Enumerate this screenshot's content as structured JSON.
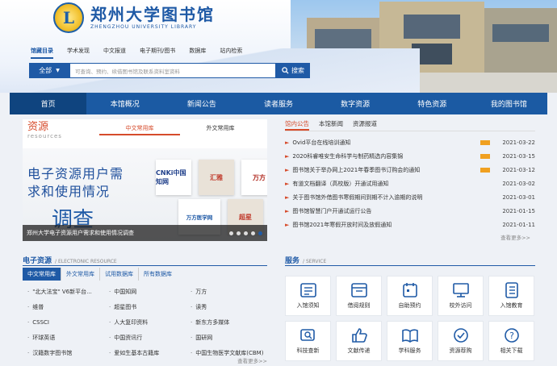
{
  "header": {
    "logo_cn": "郑州大学图书馆",
    "logo_en": "ZHENGZHOU UNIVERSITY LIBRARY",
    "emblem_letter": "L",
    "search_tabs": [
      "馆藏目录",
      "学术发现",
      "中文报道",
      "电子期刊/图书",
      "数据库",
      "站内检索"
    ],
    "active_search_tab": 0,
    "search_scope": "全部",
    "search_placeholder": "可查询、预约、续借图书馆及联系资料室资料",
    "search_button": "搜索"
  },
  "nav": {
    "items": [
      "首页",
      "本馆概况",
      "新闻公告",
      "读者服务",
      "数字资源",
      "特色资源",
      "我的图书馆"
    ],
    "active": 0
  },
  "resources": {
    "title_cn": "资源",
    "title_en": "resources",
    "tabs": [
      "中文常用库",
      "外文常用库"
    ],
    "banner_line1": "电子资源用户需",
    "banner_line2": "求和使用情况",
    "banner_big": "调查",
    "banner_caption": "郑州大学电子资源用户需求和使用情况调查",
    "logos": [
      "CNKi中国知网",
      "汇雅",
      "万方",
      "万方医学网",
      "超星"
    ]
  },
  "news": {
    "tabs": [
      "馆内公告",
      "本馆新闻",
      "资源报道"
    ],
    "items": [
      {
        "title": "Ovid平台在线培训通知",
        "date": "2021-03-22",
        "new": true
      },
      {
        "title": "2020科睿唯安生命科学与制药精选内容集锦",
        "date": "2021-03-15",
        "new": true
      },
      {
        "title": "图书馆关于举办网上2021年春季图书订购会的通知",
        "date": "2021-03-12",
        "new": true
      },
      {
        "title": "有道文档翻译（高校版）开通试用通知",
        "date": "2021-03-02",
        "new": false
      },
      {
        "title": "关于图书馆外借图书寒假期间到期不计入逾期的说明",
        "date": "2021-03-01",
        "new": false
      },
      {
        "title": "图书馆智慧门户开通试运行公告",
        "date": "2021-01-15",
        "new": false
      },
      {
        "title": "图书馆2021年寒假开放时间及放假通知",
        "date": "2021-01-11",
        "new": false
      }
    ],
    "more": "查看更多>>"
  },
  "eresources": {
    "title": "电子资源",
    "subtitle": "/ ELECTRONIC RESOURCE",
    "tabs": [
      "中文常用库",
      "外文常用库",
      "试用数据库",
      "所有数据库"
    ],
    "items": [
      "\"北大法宝\" V6新平台...",
      "中国知网",
      "万方",
      "维普",
      "超星图书",
      "读秀",
      "CSSCI",
      "人大复印资料",
      "新东方多媒体",
      "环球英语",
      "中国资讯行",
      "国研网",
      "汉籍数字图书馆",
      "爱如生基本古籍库",
      "中国生物医学文献库(CBM)"
    ],
    "more": "查看更多>>"
  },
  "service": {
    "title": "服务",
    "subtitle": "/ SERVICE",
    "items": [
      {
        "label": "入馆须知",
        "icon": "notice-icon"
      },
      {
        "label": "借阅规则",
        "icon": "rules-icon"
      },
      {
        "label": "自助预约",
        "icon": "reserve-icon"
      },
      {
        "label": "校外访问",
        "icon": "remote-access-icon"
      },
      {
        "label": "入馆教育",
        "icon": "education-icon"
      },
      {
        "label": "科技查新",
        "icon": "search-novelty-icon"
      },
      {
        "label": "文献传递",
        "icon": "thumbs-up-icon"
      },
      {
        "label": "学科服务",
        "icon": "book-icon"
      },
      {
        "label": "资源荐购",
        "icon": "recommend-icon"
      },
      {
        "label": "相关下载",
        "icon": "question-icon"
      }
    ]
  },
  "colors": {
    "primary": "#1b5aa3",
    "accent": "#d64b2b",
    "new_badge": "#f0a020"
  }
}
